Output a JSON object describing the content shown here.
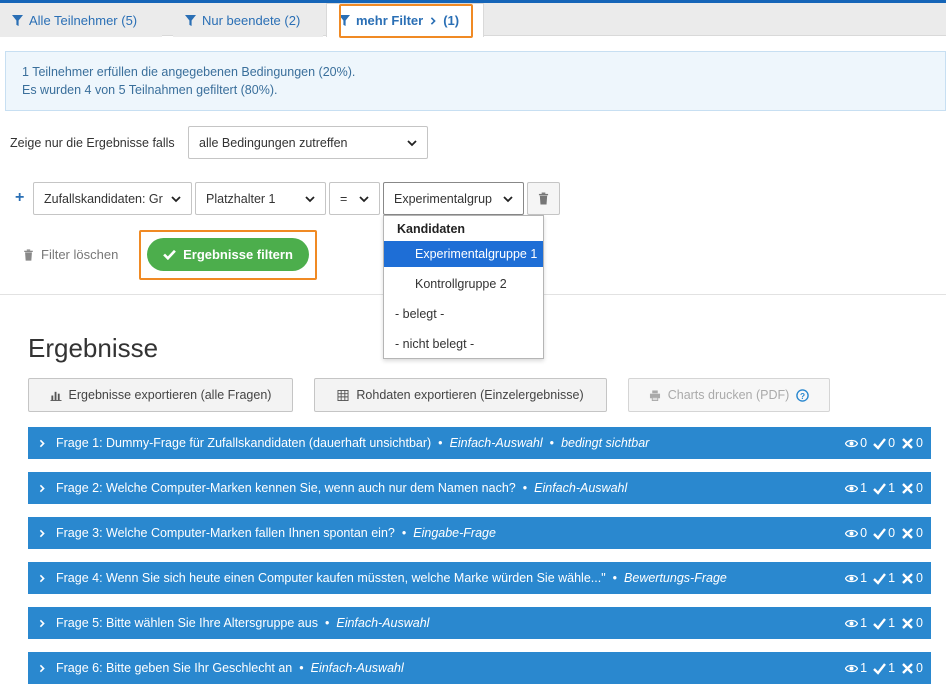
{
  "tabs": [
    {
      "label": "Alle Teilnehmer (5)",
      "icon": "filter-icon"
    },
    {
      "label": "Nur beendete (2)",
      "icon": "filter-icon"
    },
    {
      "label": "mehr Filter",
      "count": "(1)",
      "icon": "filter-icon"
    }
  ],
  "info": {
    "line1": "1 Teilnehmer erfüllen die angegebenen Bedingungen (20%).",
    "line2": "Es wurden 4 von 5 Teilnahmen gefiltert (80%)."
  },
  "condition": {
    "label": "Zeige nur die Ergebnisse falls",
    "value": "alle Bedingungen zutreffen"
  },
  "filter_row": {
    "field": "Zufallskandidaten: Gr",
    "placeholder": "Platzhalter 1",
    "operator": "=",
    "value": "Experimentalgrup"
  },
  "actions": {
    "clear_label": "Filter löschen",
    "apply_label": "Ergebnisse filtern"
  },
  "dropdown": {
    "group": "Kandidaten",
    "items": [
      "Experimentalgruppe 1",
      "Kontrollgruppe 2",
      "- belegt -",
      "- nicht belegt -"
    ],
    "selected_index": 0
  },
  "results": {
    "title": "Ergebnisse",
    "export_all": "Ergebnisse exportieren (alle Fragen)",
    "export_raw": "Rohdaten exportieren (Einzelergebnisse)",
    "print_pdf": "Charts drucken (PDF)"
  },
  "questions": [
    {
      "text": "Frage 1: Dummy-Frage für Zufallskandidaten (dauerhaft unsichtbar)",
      "type": "Einfach-Auswahl",
      "extra": "bedingt sichtbar",
      "views": "0",
      "ok": "0",
      "x": "0"
    },
    {
      "text": "Frage 2: Welche Computer-Marken kennen Sie, wenn auch nur dem Namen nach?",
      "type": "Einfach-Auswahl",
      "extra": "",
      "views": "1",
      "ok": "1",
      "x": "0"
    },
    {
      "text": "Frage 3: Welche Computer-Marken fallen Ihnen spontan ein?",
      "type": "Eingabe-Frage",
      "extra": "",
      "views": "0",
      "ok": "0",
      "x": "0"
    },
    {
      "text": "Frage 4: Wenn Sie sich heute einen Computer kaufen müssten, welche Marke würden Sie wähle...\"",
      "type": "Bewertungs-Frage",
      "extra": "",
      "views": "1",
      "ok": "1",
      "x": "0"
    },
    {
      "text": "Frage 5: Bitte wählen Sie Ihre Altersgruppe aus",
      "type": "Einfach-Auswahl",
      "extra": "",
      "views": "1",
      "ok": "1",
      "x": "0"
    },
    {
      "text": "Frage 6: Bitte geben Sie Ihr Geschlecht an",
      "type": "Einfach-Auswahl",
      "extra": "",
      "views": "1",
      "ok": "1",
      "x": "0"
    }
  ],
  "colors": {
    "accent": "#2a88cf",
    "green": "#4cae4c",
    "highlight": "#f08a24",
    "selected": "#1e6ed6"
  }
}
